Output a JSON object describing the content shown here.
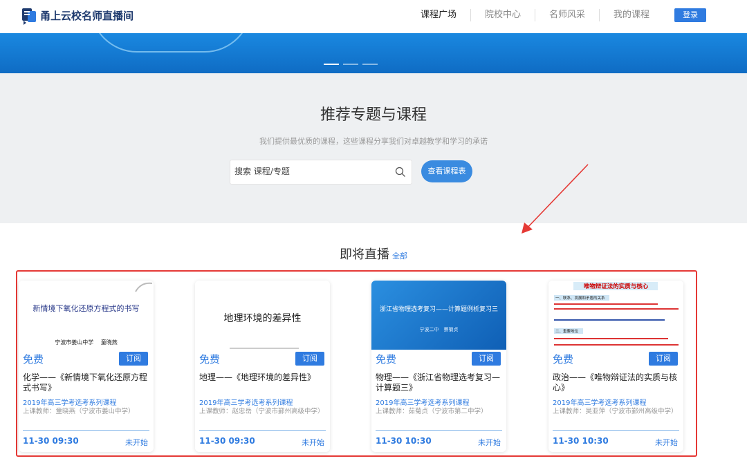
{
  "header": {
    "logo_text": "甬上云校名师直播间",
    "nav": [
      "课程广场",
      "院校中心",
      "名师风采",
      "我的课程"
    ],
    "login_label": "登录"
  },
  "recommend": {
    "title": "推荐专题与课程",
    "subtitle": "我们提供最优质的课程，这些课程分享我们对卓越教学和学习的承诺",
    "search_placeholder": "搜索 课程/专题",
    "schedule_button": "查看课程表"
  },
  "live": {
    "title": "即将直播",
    "all_link": "全部"
  },
  "colors": {
    "accent": "#2f7be0",
    "highlight": "#e53935"
  },
  "cards": [
    {
      "thumb_title": "新情境下氧化还原方程式的书写",
      "thumb_sub": "宁波市姜山中学　 童晓燕",
      "price": "免费",
      "subscribe": "订阅",
      "title": "化学——《新情境下氧化还原方程式书写》",
      "series": "2019年高三学考选考系列课程",
      "teacher": "上课教师：童晓燕（宁波市姜山中学）",
      "time": "11-30 09:30",
      "status": "未开始"
    },
    {
      "thumb_title": "地理环境的差异性",
      "price": "免费",
      "subscribe": "订阅",
      "title": "地理——《地理环境的差异性》",
      "series": "2019年高三学考选考系列课程",
      "teacher": "上课教师：赵忠岳（宁波市鄞州高级中学）",
      "time": "11-30 09:30",
      "status": "未开始"
    },
    {
      "thumb_title": "浙江省物理选考复习——计算题例析复习三",
      "thumb_sub": "宁波二中　蔡菊贞",
      "price": "免费",
      "subscribe": "订阅",
      "title": "物理——《浙江省物理选考复习—计算题三》",
      "series": "2019年高三学考选考系列课程",
      "teacher": "上课教师：茹菊贞（宁波市第二中学）",
      "time": "11-30 10:30",
      "status": "未开始"
    },
    {
      "thumb_title": "唯物辩证法的实质与核心",
      "thumb_sec1": "一、联系、发展和矛盾的关系",
      "thumb_sec2": "二、重要地位",
      "price": "免费",
      "subscribe": "订阅",
      "title": "政治——《唯物辩证法的实质与核心》",
      "series": "2019年高三学考选考系列课程",
      "teacher": "上课教师：吴亚萍（宁波市鄞州高级中学）",
      "time": "11-30 10:30",
      "status": "未开始"
    }
  ]
}
